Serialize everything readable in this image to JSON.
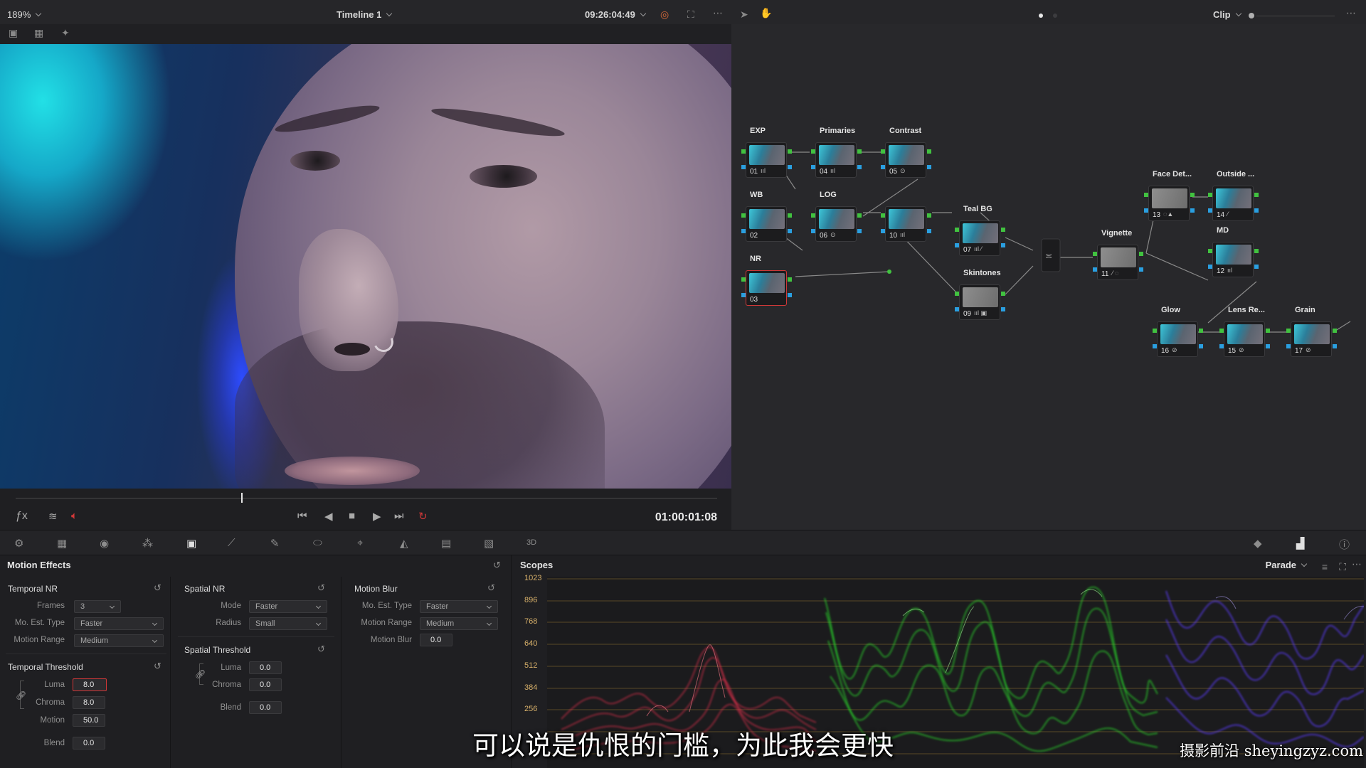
{
  "topbar": {
    "zoom": "189%",
    "timeline_name": "Timeline 1",
    "timecode": "09:26:04:49",
    "mode": "Clip"
  },
  "transport": {
    "timecode": "01:00:01:08"
  },
  "nodes": [
    {
      "label": "EXP",
      "num": "01",
      "ind": "ııl"
    },
    {
      "label": "Primaries",
      "num": "04",
      "ind": "ııl"
    },
    {
      "label": "Contrast",
      "num": "05",
      "ind": "⊙"
    },
    {
      "label": "WB",
      "num": "02",
      "ind": ""
    },
    {
      "label": "LOG",
      "num": "06",
      "ind": "⊙"
    },
    {
      "label": "",
      "num": "10",
      "ind": "ııl"
    },
    {
      "label": "NR",
      "num": "03",
      "ind": ""
    },
    {
      "label": "Teal BG",
      "num": "07",
      "ind": "ııl ⁄"
    },
    {
      "label": "Skintones",
      "num": "09",
      "ind": "ııl ▣"
    },
    {
      "label": "Vignette",
      "num": "11",
      "ind": "⁄ ◌"
    },
    {
      "label": "Face Det...",
      "num": "13",
      "ind": "◌▲"
    },
    {
      "label": "Outside ...",
      "num": "14",
      "ind": "⁄"
    },
    {
      "label": "MD",
      "num": "12",
      "ind": "ııl"
    },
    {
      "label": "Glow",
      "num": "16",
      "ind": "⊘"
    },
    {
      "label": "Lens Re...",
      "num": "15",
      "ind": "⊘"
    },
    {
      "label": "Grain",
      "num": "17",
      "ind": "⊘"
    }
  ],
  "motion": {
    "title": "Motion Effects",
    "temporal_nr": {
      "title": "Temporal NR",
      "frames_label": "Frames",
      "frames_value": "3",
      "mo_est_label": "Mo. Est. Type",
      "mo_est_value": "Faster",
      "motion_range_label": "Motion Range",
      "motion_range_value": "Medium"
    },
    "temporal_threshold": {
      "title": "Temporal Threshold",
      "luma_label": "Luma",
      "luma_value": "8.0",
      "chroma_label": "Chroma",
      "chroma_value": "8.0",
      "motion_label": "Motion",
      "motion_value": "50.0",
      "blend_label": "Blend",
      "blend_value": "0.0"
    },
    "spatial_nr": {
      "title": "Spatial NR",
      "mode_label": "Mode",
      "mode_value": "Faster",
      "radius_label": "Radius",
      "radius_value": "Small"
    },
    "spatial_threshold": {
      "title": "Spatial Threshold",
      "luma_label": "Luma",
      "luma_value": "0.0",
      "chroma_label": "Chroma",
      "chroma_value": "0.0",
      "blend_label": "Blend",
      "blend_value": "0.0"
    },
    "motion_blur": {
      "title": "Motion Blur",
      "mo_est_label": "Mo. Est. Type",
      "mo_est_value": "Faster",
      "motion_range_label": "Motion Range",
      "motion_range_value": "Medium",
      "motion_blur_label": "Motion Blur",
      "motion_blur_value": "0.0"
    }
  },
  "scopes": {
    "title": "Scopes",
    "type": "Parade",
    "y_ticks": [
      "1023",
      "896",
      "768",
      "640",
      "512",
      "384",
      "256"
    ]
  },
  "overlay": {
    "subtitle": "可以说是仇恨的门槛，为此我会更快",
    "watermark": "摄影前沿 sheyingzyz.com"
  },
  "colors": {
    "accent_red": "#d03838",
    "pin_green": "#41c240",
    "pin_blue": "#2a9fe0",
    "scope_label": "#d7b06a"
  }
}
